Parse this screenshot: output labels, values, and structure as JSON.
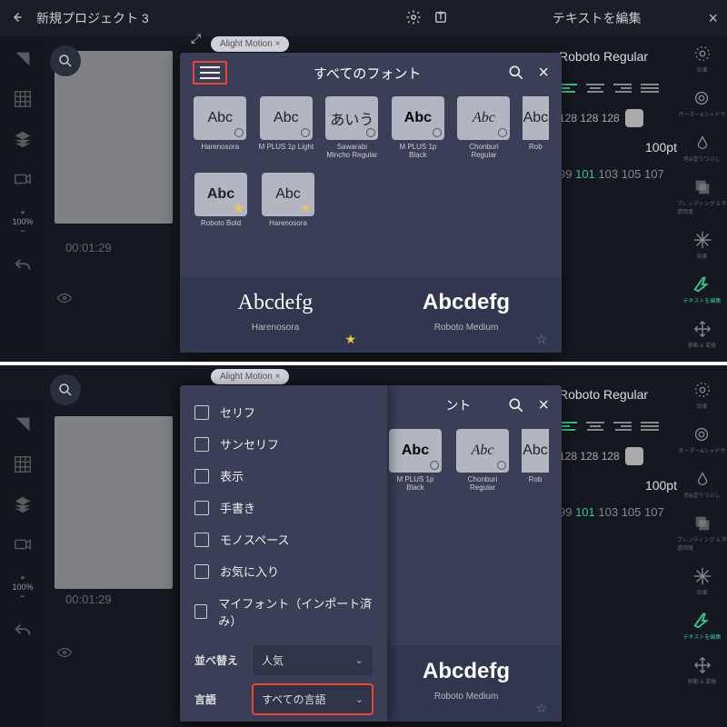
{
  "app": {
    "project_title": "新規プロジェクト 3",
    "edit_text_title": "テキストを編集",
    "timecode": "00:01:29",
    "zoom_pct_1": "+",
    "zoom_pct_2": "100%",
    "zoom_pct_3": "−"
  },
  "right": {
    "font_name": "Roboto Regular",
    "rgb": "128 128 128",
    "size": "100pt",
    "glyphs_pre": "99 ",
    "glyphs_hl": "101",
    "glyphs_post": " 103 105 107"
  },
  "rtool": {
    "t0": "効果",
    "t1": "ボーダー&シャドウ",
    "t2": "色&塗りつぶし",
    "t3": "ブレンディング & 不透明度",
    "t4": "効果",
    "t5": "テキストを編集",
    "t6": "移動 & 変換"
  },
  "dialog": {
    "title": "すべてのフォント",
    "sample_abc": "Abc",
    "sample_jp": "あいう",
    "fonts": {
      "f0": "Harenosora",
      "f1": "M PLUS 1p Light",
      "f2": "Sawarabi Mincho Regular",
      "f3": "M PLUS 1p Black",
      "f4": "Chonburi Regular",
      "f5": "Rob",
      "f6": "Roboto Bold",
      "f7": "Harenosora"
    },
    "preview": {
      "sample": "Abcdefg",
      "name_a": "Harenosora",
      "name_b": "Roboto Medium"
    }
  },
  "drawer": {
    "c0": "セリフ",
    "c1": "サンセリフ",
    "c2": "表示",
    "c3": "手書き",
    "c4": "モノスペース",
    "c5": "お気に入り",
    "c6": "マイフォント（インポート済み）",
    "sort_label": "並べ替え",
    "sort_value": "人気",
    "lang_label": "言語",
    "lang_value": "すべての言語"
  },
  "tag": "Alight Motion ×"
}
